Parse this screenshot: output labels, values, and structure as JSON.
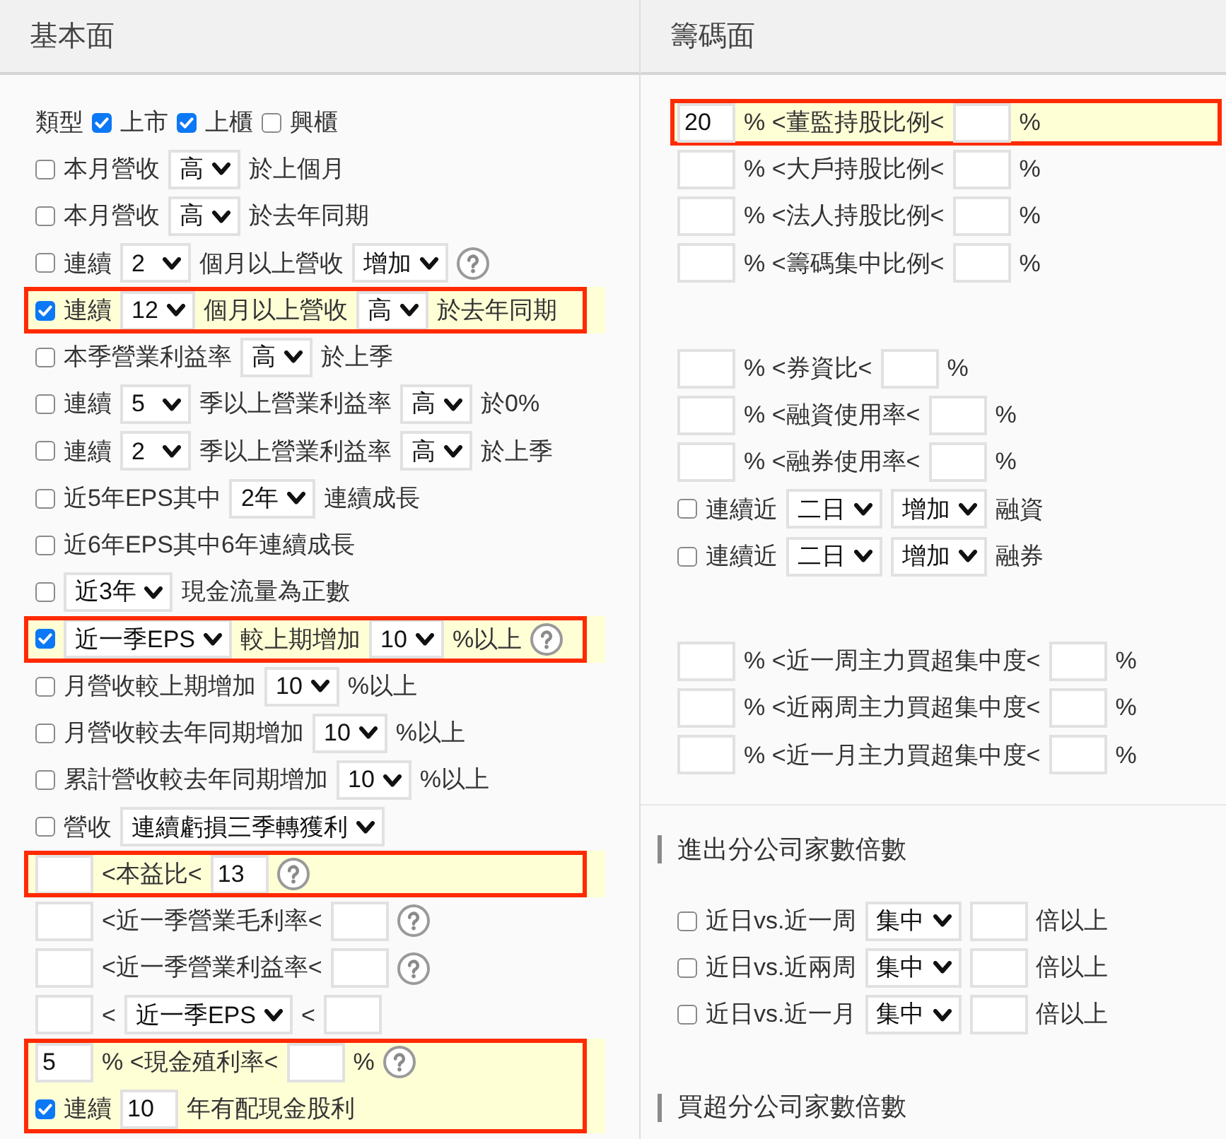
{
  "left": {
    "title": "基本面",
    "blocks": [
      {
        "highlighted": false,
        "rows": [
          [
            {
              "kind": "text",
              "text": "類型"
            },
            {
              "kind": "checkbox",
              "checked": true
            },
            {
              "kind": "text",
              "text": "上市"
            },
            {
              "kind": "checkbox",
              "checked": true
            },
            {
              "kind": "text",
              "text": "上櫃"
            },
            {
              "kind": "checkbox",
              "checked": false
            },
            {
              "kind": "text",
              "text": "興櫃"
            }
          ]
        ]
      },
      {
        "highlighted": false,
        "rows": [
          [
            {
              "kind": "checkbox",
              "checked": false
            },
            {
              "kind": "text",
              "text": "本月營收"
            },
            {
              "kind": "select",
              "value": "高"
            },
            {
              "kind": "text",
              "text": "於上個月"
            }
          ]
        ]
      },
      {
        "highlighted": false,
        "rows": [
          [
            {
              "kind": "checkbox",
              "checked": false
            },
            {
              "kind": "text",
              "text": "本月營收"
            },
            {
              "kind": "select",
              "value": "高"
            },
            {
              "kind": "text",
              "text": "於去年同期"
            }
          ]
        ]
      },
      {
        "highlighted": false,
        "rows": [
          [
            {
              "kind": "checkbox",
              "checked": false
            },
            {
              "kind": "text",
              "text": "連續"
            },
            {
              "kind": "select",
              "value": "2"
            },
            {
              "kind": "text",
              "text": "個月以上營收"
            },
            {
              "kind": "select",
              "value": "增加"
            },
            {
              "kind": "help"
            }
          ]
        ]
      },
      {
        "highlighted": true,
        "rows": [
          [
            {
              "kind": "checkbox",
              "checked": true
            },
            {
              "kind": "text",
              "text": "連續"
            },
            {
              "kind": "select",
              "value": "12"
            },
            {
              "kind": "text",
              "text": "個月以上營收"
            },
            {
              "kind": "select",
              "value": "高"
            },
            {
              "kind": "text",
              "text": "於去年同期"
            }
          ]
        ]
      },
      {
        "highlighted": false,
        "rows": [
          [
            {
              "kind": "checkbox",
              "checked": false
            },
            {
              "kind": "text",
              "text": "本季營業利益率"
            },
            {
              "kind": "select",
              "value": "高"
            },
            {
              "kind": "text",
              "text": "於上季"
            }
          ]
        ]
      },
      {
        "highlighted": false,
        "rows": [
          [
            {
              "kind": "checkbox",
              "checked": false
            },
            {
              "kind": "text",
              "text": "連續"
            },
            {
              "kind": "select",
              "value": "5"
            },
            {
              "kind": "text",
              "text": "季以上營業利益率"
            },
            {
              "kind": "select",
              "value": "高"
            },
            {
              "kind": "text",
              "text": "於0%"
            }
          ]
        ]
      },
      {
        "highlighted": false,
        "rows": [
          [
            {
              "kind": "checkbox",
              "checked": false
            },
            {
              "kind": "text",
              "text": "連續"
            },
            {
              "kind": "select",
              "value": "2"
            },
            {
              "kind": "text",
              "text": "季以上營業利益率"
            },
            {
              "kind": "select",
              "value": "高"
            },
            {
              "kind": "text",
              "text": "於上季"
            }
          ]
        ]
      },
      {
        "highlighted": false,
        "rows": [
          [
            {
              "kind": "checkbox",
              "checked": false
            },
            {
              "kind": "text",
              "text": "近5年EPS其中"
            },
            {
              "kind": "select",
              "value": "2年"
            },
            {
              "kind": "text",
              "text": "連續成長"
            }
          ]
        ]
      },
      {
        "highlighted": false,
        "rows": [
          [
            {
              "kind": "checkbox",
              "checked": false
            },
            {
              "kind": "text",
              "text": "近6年EPS其中6年連續成長"
            }
          ]
        ]
      },
      {
        "highlighted": false,
        "rows": [
          [
            {
              "kind": "checkbox",
              "checked": false
            },
            {
              "kind": "select",
              "value": "近3年"
            },
            {
              "kind": "text",
              "text": "現金流量為正數"
            }
          ]
        ]
      },
      {
        "highlighted": true,
        "rows": [
          [
            {
              "kind": "checkbox",
              "checked": true
            },
            {
              "kind": "select",
              "value": "近一季EPS"
            },
            {
              "kind": "text",
              "text": "較上期增加"
            },
            {
              "kind": "select",
              "value": "10"
            },
            {
              "kind": "text",
              "text": "%以上"
            },
            {
              "kind": "help"
            }
          ]
        ]
      },
      {
        "highlighted": false,
        "rows": [
          [
            {
              "kind": "checkbox",
              "checked": false
            },
            {
              "kind": "text",
              "text": "月營收較上期增加"
            },
            {
              "kind": "select",
              "value": "10"
            },
            {
              "kind": "text",
              "text": "%以上"
            }
          ]
        ]
      },
      {
        "highlighted": false,
        "rows": [
          [
            {
              "kind": "checkbox",
              "checked": false
            },
            {
              "kind": "text",
              "text": "月營收較去年同期增加"
            },
            {
              "kind": "select",
              "value": "10"
            },
            {
              "kind": "text",
              "text": "%以上"
            }
          ]
        ]
      },
      {
        "highlighted": false,
        "rows": [
          [
            {
              "kind": "checkbox",
              "checked": false
            },
            {
              "kind": "text",
              "text": "累計營收較去年同期增加"
            },
            {
              "kind": "select",
              "value": "10"
            },
            {
              "kind": "text",
              "text": "%以上"
            }
          ]
        ]
      },
      {
        "highlighted": false,
        "rows": [
          [
            {
              "kind": "checkbox",
              "checked": false
            },
            {
              "kind": "text",
              "text": "營收"
            },
            {
              "kind": "select",
              "value": "連續虧損三季轉獲利"
            }
          ]
        ]
      },
      {
        "highlighted": true,
        "rows": [
          [
            {
              "kind": "input"
            },
            {
              "kind": "text",
              "text": "<本益比<"
            },
            {
              "kind": "input",
              "value": "13"
            },
            {
              "kind": "help"
            }
          ]
        ]
      },
      {
        "highlighted": false,
        "rows": [
          [
            {
              "kind": "input"
            },
            {
              "kind": "text",
              "text": "<近一季營業毛利率<"
            },
            {
              "kind": "input"
            },
            {
              "kind": "help"
            }
          ]
        ]
      },
      {
        "highlighted": false,
        "rows": [
          [
            {
              "kind": "input"
            },
            {
              "kind": "text",
              "text": "<近一季營業利益率<"
            },
            {
              "kind": "input"
            },
            {
              "kind": "help"
            }
          ]
        ]
      },
      {
        "highlighted": false,
        "rows": [
          [
            {
              "kind": "input"
            },
            {
              "kind": "text",
              "text": "<"
            },
            {
              "kind": "select",
              "value": "近一季EPS"
            },
            {
              "kind": "text",
              "text": "<"
            },
            {
              "kind": "input"
            }
          ]
        ]
      },
      {
        "highlighted": true,
        "rows": [
          [
            {
              "kind": "input",
              "value": "5"
            },
            {
              "kind": "text",
              "text": "% <現金殖利率<"
            },
            {
              "kind": "input"
            },
            {
              "kind": "text",
              "text": "%"
            },
            {
              "kind": "help"
            }
          ],
          [
            {
              "kind": "checkbox",
              "checked": true
            },
            {
              "kind": "text",
              "text": "連續"
            },
            {
              "kind": "input",
              "value": "10"
            },
            {
              "kind": "text",
              "text": "年有配現金股利"
            }
          ]
        ]
      }
    ]
  },
  "right": {
    "title": "籌碼面",
    "groups": [
      {
        "blocks": [
          {
            "highlighted": true,
            "rows": [
              [
                {
                  "kind": "input",
                  "value": "20"
                },
                {
                  "kind": "text",
                  "text": "% <董監持股比例<"
                },
                {
                  "kind": "input"
                },
                {
                  "kind": "text",
                  "text": "%"
                }
              ]
            ]
          },
          {
            "highlighted": false,
            "rows": [
              [
                {
                  "kind": "input"
                },
                {
                  "kind": "text",
                  "text": "% <大戶持股比例<"
                },
                {
                  "kind": "input"
                },
                {
                  "kind": "text",
                  "text": "%"
                }
              ],
              [
                {
                  "kind": "input"
                },
                {
                  "kind": "text",
                  "text": "% <法人持股比例<"
                },
                {
                  "kind": "input"
                },
                {
                  "kind": "text",
                  "text": "%"
                }
              ],
              [
                {
                  "kind": "input"
                },
                {
                  "kind": "text",
                  "text": "% <籌碼集中比例<"
                },
                {
                  "kind": "input"
                },
                {
                  "kind": "text",
                  "text": "%"
                }
              ]
            ]
          }
        ]
      },
      {
        "blocks": [
          {
            "highlighted": false,
            "rows": [
              [
                {
                  "kind": "input"
                },
                {
                  "kind": "text",
                  "text": "% <券資比<"
                },
                {
                  "kind": "input"
                },
                {
                  "kind": "text",
                  "text": "%"
                }
              ],
              [
                {
                  "kind": "input"
                },
                {
                  "kind": "text",
                  "text": "% <融資使用率<"
                },
                {
                  "kind": "input"
                },
                {
                  "kind": "text",
                  "text": "%"
                }
              ],
              [
                {
                  "kind": "input"
                },
                {
                  "kind": "text",
                  "text": "% <融券使用率<"
                },
                {
                  "kind": "input"
                },
                {
                  "kind": "text",
                  "text": "%"
                }
              ],
              [
                {
                  "kind": "checkbox",
                  "checked": false
                },
                {
                  "kind": "text",
                  "text": "連續近"
                },
                {
                  "kind": "select",
                  "value": "二日"
                },
                {
                  "kind": "select",
                  "value": "增加"
                },
                {
                  "kind": "text",
                  "text": "融資"
                }
              ],
              [
                {
                  "kind": "checkbox",
                  "checked": false
                },
                {
                  "kind": "text",
                  "text": "連續近"
                },
                {
                  "kind": "select",
                  "value": "二日"
                },
                {
                  "kind": "select",
                  "value": "增加"
                },
                {
                  "kind": "text",
                  "text": "融券"
                }
              ]
            ]
          }
        ]
      },
      {
        "blocks": [
          {
            "highlighted": false,
            "rows": [
              [
                {
                  "kind": "input"
                },
                {
                  "kind": "text",
                  "text": "% <近一周主力買超集中度<"
                },
                {
                  "kind": "input"
                },
                {
                  "kind": "text",
                  "text": "%"
                }
              ],
              [
                {
                  "kind": "input"
                },
                {
                  "kind": "text",
                  "text": "% <近兩周主力買超集中度<"
                },
                {
                  "kind": "input"
                },
                {
                  "kind": "text",
                  "text": "%"
                }
              ],
              [
                {
                  "kind": "input"
                },
                {
                  "kind": "text",
                  "text": "% <近一月主力買超集中度<"
                },
                {
                  "kind": "input"
                },
                {
                  "kind": "text",
                  "text": "%"
                }
              ]
            ]
          }
        ]
      }
    ],
    "sections": [
      {
        "heading": "進出分公司家數倍數",
        "rows": [
          [
            {
              "kind": "checkbox",
              "checked": false
            },
            {
              "kind": "text",
              "text": "近日vs.近一周"
            },
            {
              "kind": "select",
              "value": "集中"
            },
            {
              "kind": "input"
            },
            {
              "kind": "text",
              "text": "倍以上"
            }
          ],
          [
            {
              "kind": "checkbox",
              "checked": false
            },
            {
              "kind": "text",
              "text": "近日vs.近兩周"
            },
            {
              "kind": "select",
              "value": "集中"
            },
            {
              "kind": "input"
            },
            {
              "kind": "text",
              "text": "倍以上"
            }
          ],
          [
            {
              "kind": "checkbox",
              "checked": false
            },
            {
              "kind": "text",
              "text": "近日vs.近一月"
            },
            {
              "kind": "select",
              "value": "集中"
            },
            {
              "kind": "input"
            },
            {
              "kind": "text",
              "text": "倍以上"
            }
          ]
        ]
      },
      {
        "heading": "買超分公司家數倍數"
      }
    ]
  }
}
